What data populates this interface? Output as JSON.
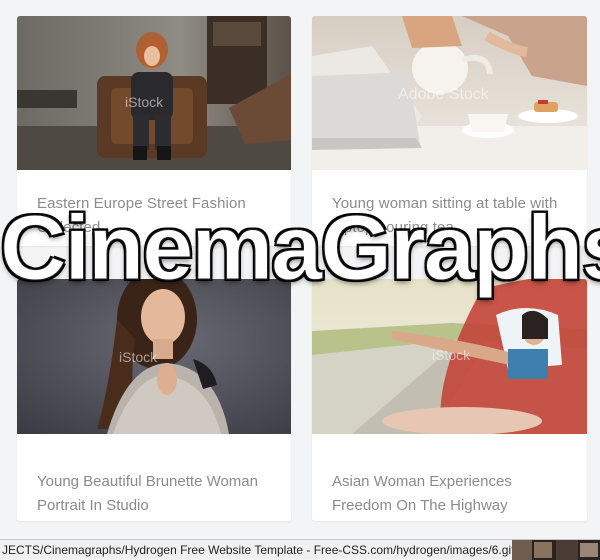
{
  "overlay": {
    "title": "CinemaGraphs"
  },
  "cards": [
    {
      "caption": "Eastern Europe Street Fashion Collected",
      "watermark": "iStock"
    },
    {
      "caption": "Young woman sitting at table with laptop pouring tea",
      "watermark": "Adobe Stock"
    },
    {
      "caption_line1": "Young Beautiful Brunette Woman",
      "caption_line2": "Portrait In Studio",
      "watermark": "iStock"
    },
    {
      "caption_line1": "Asian Woman Experiences",
      "caption_line2": "Freedom On The Highway",
      "watermark": "iStock"
    }
  ],
  "status_bar": {
    "url": "JECTS/Cinemagraphs/Hydrogen Free Website Template - Free-CSS.com/hydrogen/images/6.gif"
  },
  "colors": {
    "page_background": "#f3f4f6",
    "card_background": "#ffffff",
    "caption_text": "#8b8b8b",
    "overlay_text": "#ffffff"
  },
  "icons": {
    "status_thumbnail": "image-thumbnail-icon"
  }
}
